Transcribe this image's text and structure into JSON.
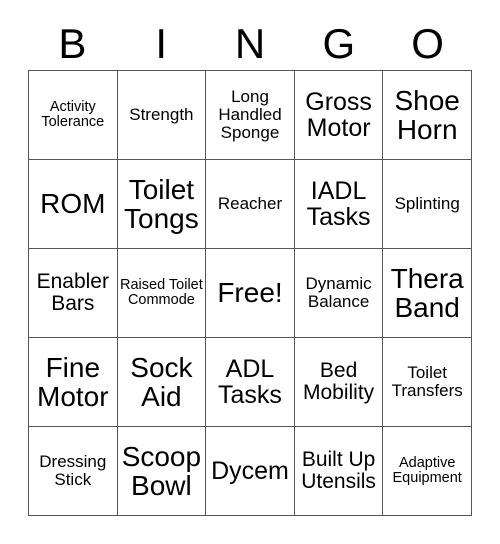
{
  "header": {
    "letters": [
      "B",
      "I",
      "N",
      "G",
      "O"
    ]
  },
  "grid": {
    "rows": [
      [
        {
          "label": "Activity Tolerance",
          "size": "s-xs"
        },
        {
          "label": "Strength",
          "size": "s-sm"
        },
        {
          "label": "Long Handled Sponge",
          "size": "s-sm"
        },
        {
          "label": "Gross Motor",
          "size": "s-lg"
        },
        {
          "label": "Shoe Horn",
          "size": "s-xl"
        }
      ],
      [
        {
          "label": "ROM",
          "size": "s-xl"
        },
        {
          "label": "Toilet Tongs",
          "size": "s-xl"
        },
        {
          "label": "Reacher",
          "size": "s-sm"
        },
        {
          "label": "IADL Tasks",
          "size": "s-lg"
        },
        {
          "label": "Splinting",
          "size": "s-sm"
        }
      ],
      [
        {
          "label": "Enabler Bars",
          "size": "s-md"
        },
        {
          "label": "Raised Toilet Commode",
          "size": "s-xs"
        },
        {
          "label": "Free!",
          "size": "s-xl"
        },
        {
          "label": "Dynamic Balance",
          "size": "s-sm"
        },
        {
          "label": "Thera Band",
          "size": "s-xl"
        }
      ],
      [
        {
          "label": "Fine Motor",
          "size": "s-xl"
        },
        {
          "label": "Sock Aid",
          "size": "s-xl"
        },
        {
          "label": "ADL Tasks",
          "size": "s-lg"
        },
        {
          "label": "Bed Mobility",
          "size": "s-md"
        },
        {
          "label": "Toilet Transfers",
          "size": "s-sm"
        }
      ],
      [
        {
          "label": "Dressing Stick",
          "size": "s-sm"
        },
        {
          "label": "Scoop Bowl",
          "size": "s-xl"
        },
        {
          "label": "Dycem",
          "size": "s-lg"
        },
        {
          "label": "Built Up Utensils",
          "size": "s-md"
        },
        {
          "label": "Adaptive Equipment",
          "size": "s-xs"
        }
      ]
    ]
  }
}
